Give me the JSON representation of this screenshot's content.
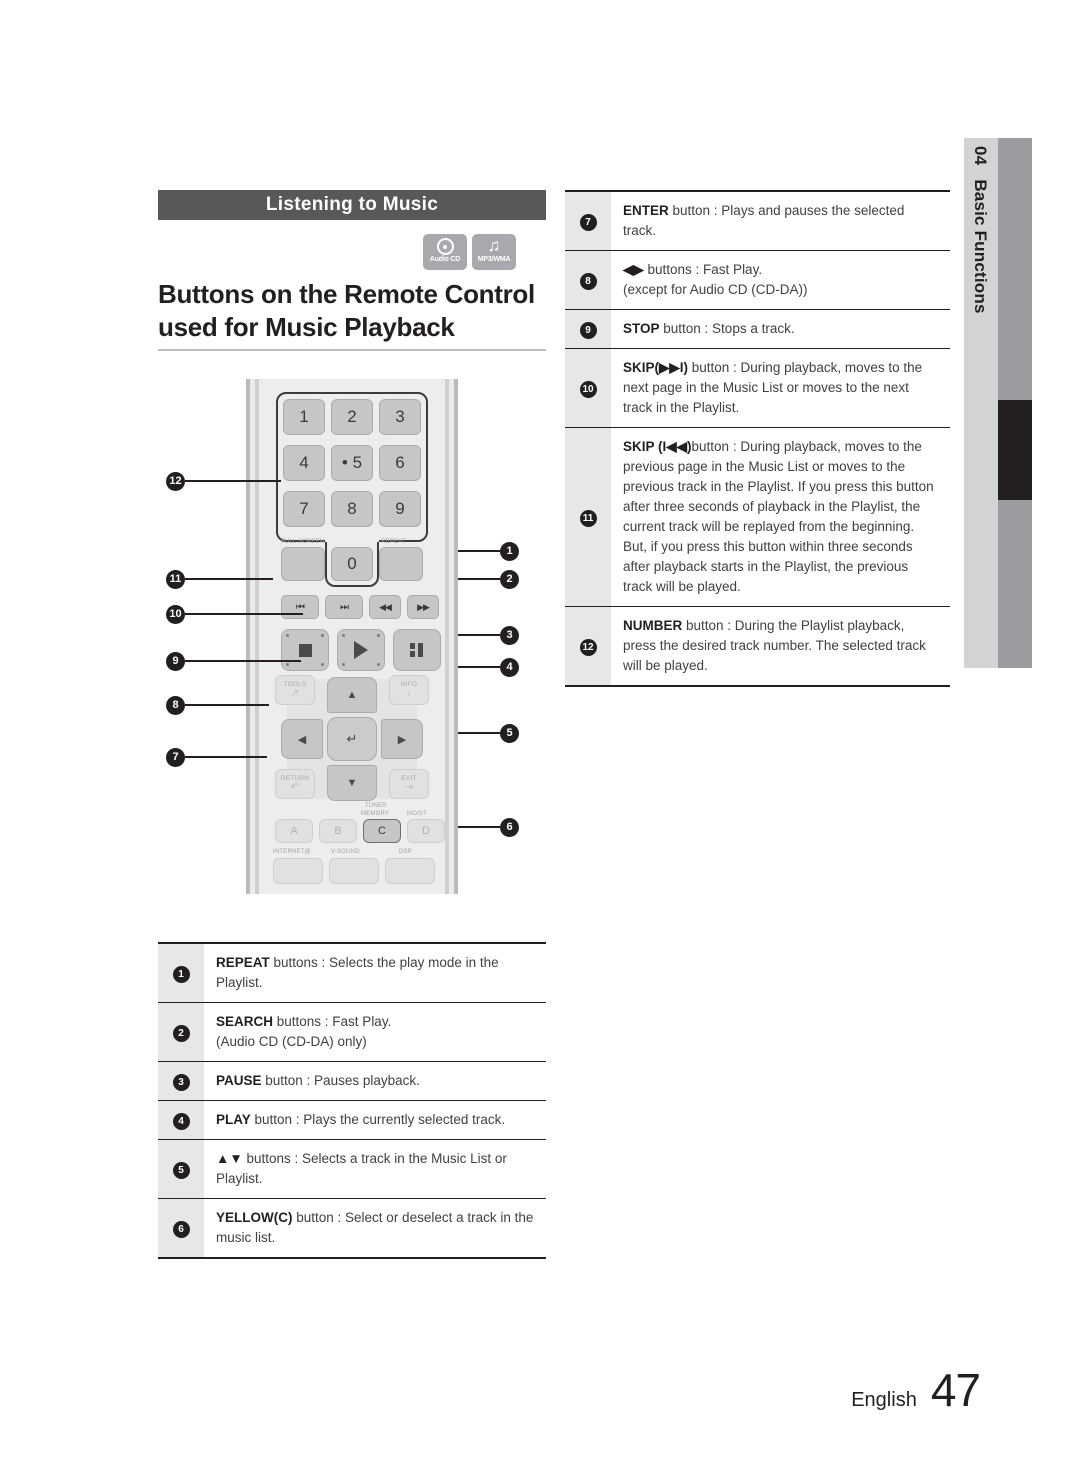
{
  "side_tab": {
    "chapter_number": "04",
    "chapter_title": "Basic Functions"
  },
  "section": {
    "banner": "Listening to Music",
    "title": "Buttons on the Remote Control used for Music Playback",
    "badges": [
      {
        "icon": "audio-cd-icon",
        "label": "Audio CD"
      },
      {
        "icon": "music-note-icon",
        "label": "MP3/WMA"
      }
    ]
  },
  "remote": {
    "keypad": [
      "1",
      "2",
      "3",
      "4",
      "• 5",
      "6",
      "7",
      "8",
      "9"
    ],
    "zero_key": "0",
    "mini_labels": {
      "full_screen": "FULL SCREEN",
      "repeat": "REPEAT",
      "tuner": "TUNER",
      "memory": "MEMORY",
      "most": "MO/ST",
      "internet": "INTERNET@",
      "vsound": "V-SOUND",
      "dsp": "DSP"
    },
    "transport": {
      "skip_back": "⏮",
      "skip_fwd": "⏭",
      "rewind": "◀◀",
      "forward": "▶▶",
      "stop": "stop-icon",
      "play": "play-icon",
      "pause": "pause-icon"
    },
    "dpad": {
      "up": "▲",
      "down": "▼",
      "left": "◀",
      "right": "▶",
      "enter": "↵",
      "tools": "TOOLS",
      "info": "INFO",
      "return": "RETURN",
      "exit": "EXIT"
    },
    "color_buttons": [
      "A",
      "B",
      "C",
      "D"
    ],
    "highlighted_color_button": "C",
    "callouts_left": [
      "12",
      "11",
      "10",
      "9",
      "8",
      "7"
    ],
    "callouts_right": [
      "1",
      "2",
      "3",
      "4",
      "5",
      "6"
    ]
  },
  "table_right": [
    {
      "num": "7",
      "bold": "ENTER",
      "rest": " button : Plays and pauses the selected track."
    },
    {
      "num": "8",
      "bold": "◀▶",
      "rest": " buttons : Fast Play.\n(except for Audio CD (CD-DA))"
    },
    {
      "num": "9",
      "bold": "STOP",
      "rest": " button : Stops a track."
    },
    {
      "num": "10",
      "bold": "SKIP(▶▶I)",
      "rest": " button : During playback, moves to the next page in the Music List or moves to the next track in the Playlist."
    },
    {
      "num": "11",
      "bold": "SKIP (I◀◀)",
      "rest": "button : During playback, moves to the previous page in the Music List or moves to the previous track in the Playlist. If you press this button after three seconds of playback in the Playlist, the current track will be replayed from the beginning. But, if you press this button within three seconds after playback starts in the Playlist, the previous track will be played."
    },
    {
      "num": "12",
      "bold": "NUMBER",
      "rest": " button : During the Playlist playback, press the desired track number. The selected track will be played."
    }
  ],
  "table_bottom": [
    {
      "num": "1",
      "bold": "REPEAT",
      "rest": " buttons : Selects the play mode in the Playlist."
    },
    {
      "num": "2",
      "bold": "SEARCH",
      "rest": " buttons : Fast Play.\n(Audio CD (CD-DA) only)"
    },
    {
      "num": "3",
      "bold": "PAUSE",
      "rest": " button : Pauses playback."
    },
    {
      "num": "4",
      "bold": "PLAY",
      "rest": " button : Plays the currently selected track."
    },
    {
      "num": "5",
      "bold": "▲▼",
      "rest": " buttons : Selects a track in the Music List or Playlist."
    },
    {
      "num": "6",
      "bold": "YELLOW(C)",
      "rest": " button : Select or deselect a track in the music list."
    }
  ],
  "footer": {
    "language": "English",
    "page_number": "47"
  }
}
